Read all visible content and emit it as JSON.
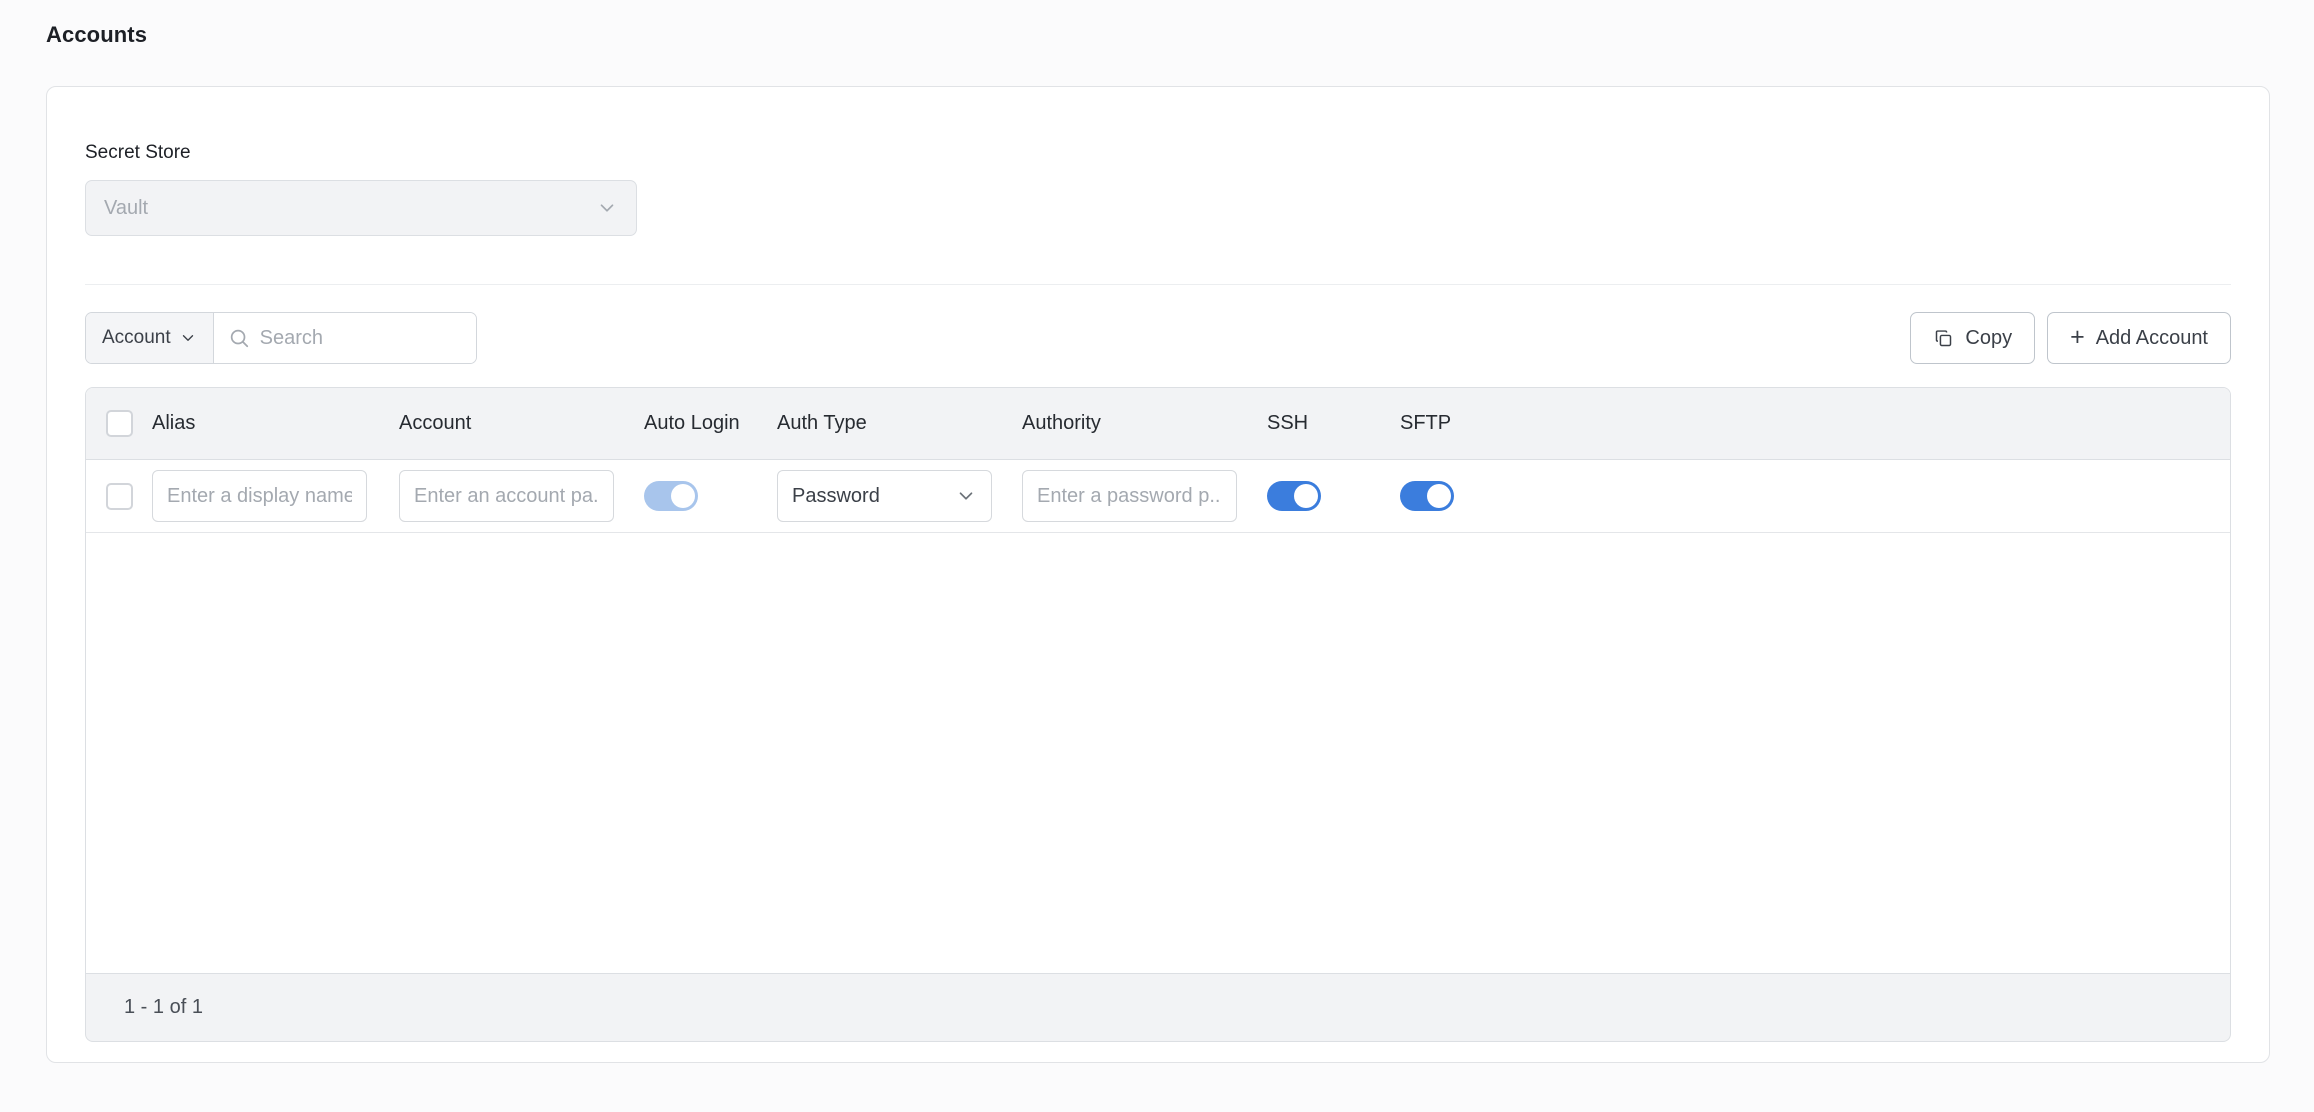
{
  "page": {
    "title": "Accounts"
  },
  "secret_store": {
    "label": "Secret Store",
    "value": "Vault",
    "chevron_icon": "chevron-down-icon"
  },
  "toolbar": {
    "filter_label": "Account",
    "filter_chevron_icon": "chevron-down-icon",
    "search_icon": "search-icon",
    "search_value": "",
    "search_placeholder": "Search",
    "copy_label": "Copy",
    "copy_icon": "copy-icon",
    "add_label": "Add Account",
    "add_icon": "plus-icon"
  },
  "table": {
    "columns": [
      {
        "key": "select",
        "label": ""
      },
      {
        "key": "alias",
        "label": "Alias"
      },
      {
        "key": "account",
        "label": "Account"
      },
      {
        "key": "auto_login",
        "label": "Auto Login"
      },
      {
        "key": "auth_type",
        "label": "Auth Type"
      },
      {
        "key": "authority",
        "label": "Authority"
      },
      {
        "key": "ssh",
        "label": "SSH"
      },
      {
        "key": "sftp",
        "label": "SFTP"
      }
    ],
    "rows": [
      {
        "selected": false,
        "alias_value": "",
        "alias_placeholder": "Enter a display name",
        "account_value": "",
        "account_placeholder": "Enter an account pa...",
        "auto_login": "on",
        "auth_type": "Password",
        "auth_type_chevron_icon": "chevron-down-icon",
        "authority_value": "",
        "authority_placeholder": "Enter a password p...",
        "ssh": "on",
        "sftp": "on"
      }
    ],
    "footer_text": "1 - 1 of 1"
  },
  "colors": {
    "accent": "#3b7ddd",
    "accent_faded": "#a8c5ec",
    "page_bg": "#fbfbfc",
    "card_bg": "#ffffff",
    "header_bg": "#f2f3f5",
    "border": "#dcdfe3",
    "text": "#272b31",
    "muted_text": "#a4a9b0"
  }
}
